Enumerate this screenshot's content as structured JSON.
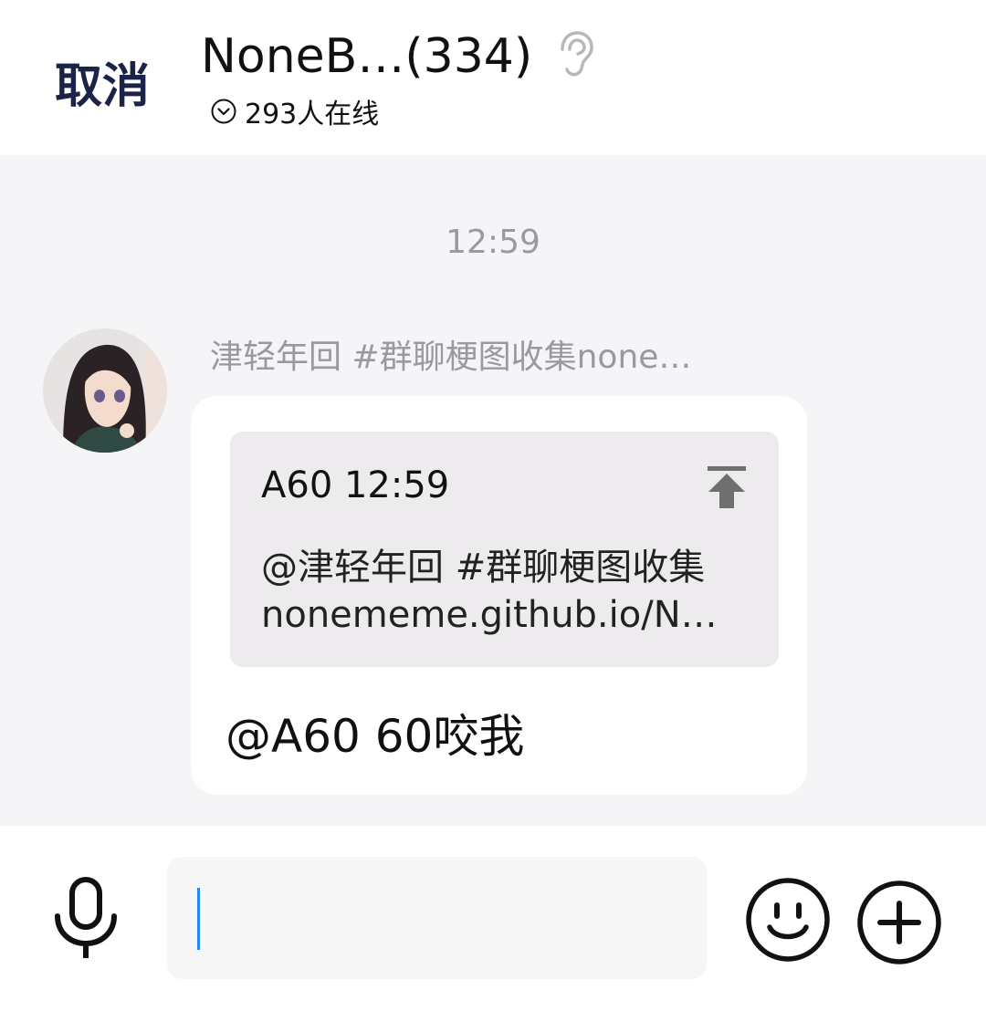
{
  "header": {
    "cancel_label": "取消",
    "group_title": "NoneB…(334)",
    "online_text": "293人在线"
  },
  "chat": {
    "timestamp": "12:59",
    "message": {
      "sender_name": "津轻年回 #群聊梗图收集none…",
      "quote": {
        "header": "A60 12:59",
        "line1": "@津轻年回 #群聊梗图收集",
        "line2": "nonememe.github.io/N…"
      },
      "text": "@A60 60咬我"
    }
  },
  "input_bar": {
    "input_value": ""
  },
  "icons": {
    "ear": "ear-icon",
    "online_dropdown": "chevron-down-circle-icon",
    "quote_jump": "arrow-up-to-top-icon",
    "voice": "microphone-icon",
    "emoji": "smiley-icon",
    "plus": "plus-circle-icon"
  },
  "colors": {
    "cancel_text": "#1b2348",
    "chat_background": "#f5f4f6",
    "quote_background": "#eeebee",
    "caret": "#1a8cff",
    "secondary_text": "#9b9b9f"
  }
}
